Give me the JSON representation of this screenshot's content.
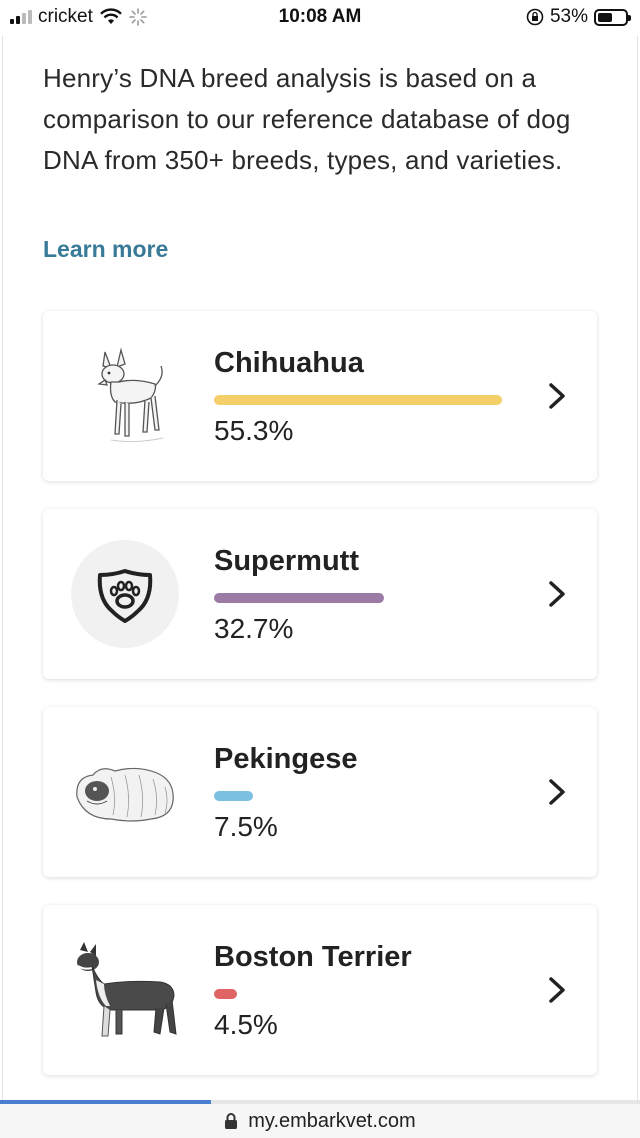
{
  "status_bar": {
    "carrier": "cricket",
    "time": "10:08 AM",
    "battery_percent": "53%",
    "battery_level": 0.53,
    "icons": [
      "signal-icon",
      "wifi-icon",
      "loading-icon",
      "orientation-lock-icon",
      "battery-icon"
    ]
  },
  "intro": {
    "text": "Henry’s DNA breed analysis is based on a comparison to our reference database of dog DNA from 350+ breeds, types, and varieties.",
    "learn_more": "Learn more"
  },
  "breeds": [
    {
      "name": "Chihuahua",
      "percent": "55.3%",
      "value": 55.3,
      "color": "#f5d06a",
      "image": "chihuahua-illustration"
    },
    {
      "name": "Supermutt",
      "percent": "32.7%",
      "value": 32.7,
      "color": "#9b7aa6",
      "image": "supermutt-paw-shield-icon"
    },
    {
      "name": "Pekingese",
      "percent": "7.5%",
      "value": 7.5,
      "color": "#7cc0e0",
      "image": "pekingese-illustration"
    },
    {
      "name": "Boston Terrier",
      "percent": "4.5%",
      "value": 4.5,
      "color": "#e06464",
      "image": "boston-terrier-illustration"
    }
  ],
  "browser": {
    "url": "my.embarkvet.com",
    "load_progress": 0.33,
    "accent": "#4a7fd0"
  },
  "colors": {
    "link": "#3a7a99"
  }
}
